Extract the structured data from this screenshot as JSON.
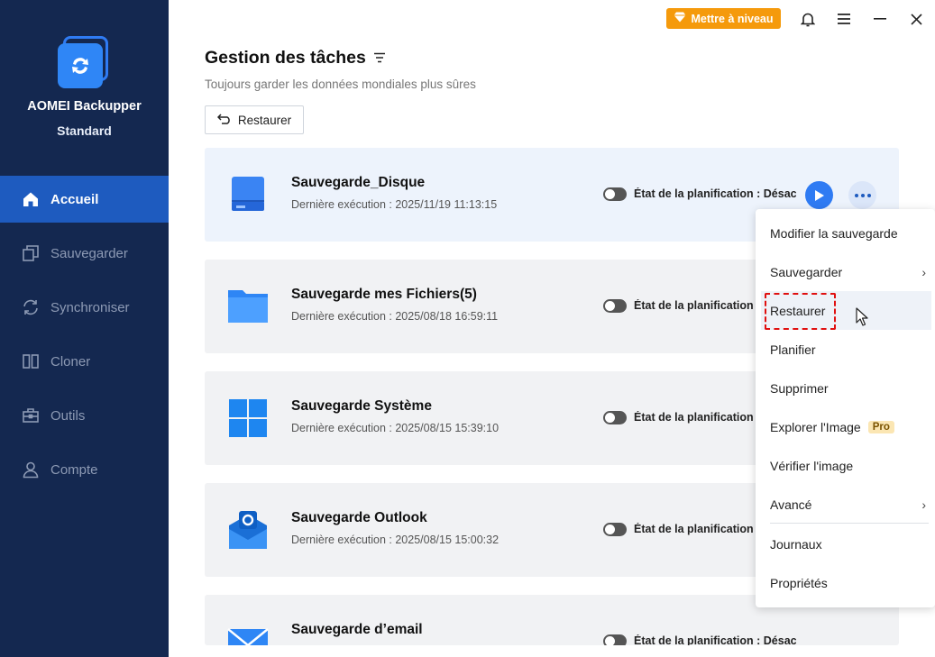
{
  "app": {
    "name": "AOMEI Backupper",
    "edition": "Standard"
  },
  "sidebar": {
    "items": [
      {
        "label": "Accueil",
        "icon": "home-icon",
        "active": true
      },
      {
        "label": "Sauvegarder",
        "icon": "backup-icon",
        "active": false
      },
      {
        "label": "Synchroniser",
        "icon": "sync-icon",
        "active": false
      },
      {
        "label": "Cloner",
        "icon": "clone-icon",
        "active": false
      },
      {
        "label": "Outils",
        "icon": "toolbox-icon",
        "active": false
      },
      {
        "label": "Compte",
        "icon": "user-icon",
        "active": false
      }
    ]
  },
  "header": {
    "upgrade_label": "Mettre à niveau"
  },
  "main": {
    "title": "Gestion des tâches",
    "subtitle": "Toujours garder les données mondiales plus sûres",
    "restore_label": "Restaurer"
  },
  "tasks": [
    {
      "name": "Sauvegarde_Disque",
      "last_run": "Dernière exécution : 2025/11/19 11:13:15",
      "schedule": "État de la planification : Désactivé",
      "icon": "disk-icon"
    },
    {
      "name": "Sauvegarde mes Fichiers(5)",
      "last_run": "Dernière exécution : 2025/08/18 16:59:11",
      "schedule": "État de la planification : Désactivé",
      "icon": "folder-icon"
    },
    {
      "name": "Sauvegarde Système",
      "last_run": "Dernière exécution : 2025/08/15 15:39:10",
      "schedule": "État de la planification : Désactivé",
      "icon": "windows-icon"
    },
    {
      "name": "Sauvegarde Outlook",
      "last_run": "Dernière exécution : 2025/08/15 15:00:32",
      "schedule": "État de la planification : Désactivé",
      "icon": "outlook-icon"
    },
    {
      "name": "Sauvegarde d’email",
      "last_run": "",
      "schedule": "État de la planification : Désactivé",
      "icon": "email-icon"
    }
  ],
  "context_menu": {
    "items": [
      {
        "label": "Modifier la sauvegarde"
      },
      {
        "label": "Sauvegarder",
        "submenu": true
      },
      {
        "label": "Restaurer",
        "hovered": true
      },
      {
        "label": "Planifier"
      },
      {
        "label": "Supprimer"
      },
      {
        "label": "Explorer l'Image",
        "badge": "Pro"
      },
      {
        "label": "Vérifier l'image"
      },
      {
        "label": "Avancé",
        "submenu": true
      },
      {
        "label": "Journaux"
      },
      {
        "label": "Propriétés"
      }
    ]
  },
  "colors": {
    "sidebar_bg": "#142850",
    "sidebar_active": "#1e5bbf",
    "accent": "#2f7bf3",
    "upgrade": "#f59a0c",
    "highlight_border": "#e01010"
  }
}
